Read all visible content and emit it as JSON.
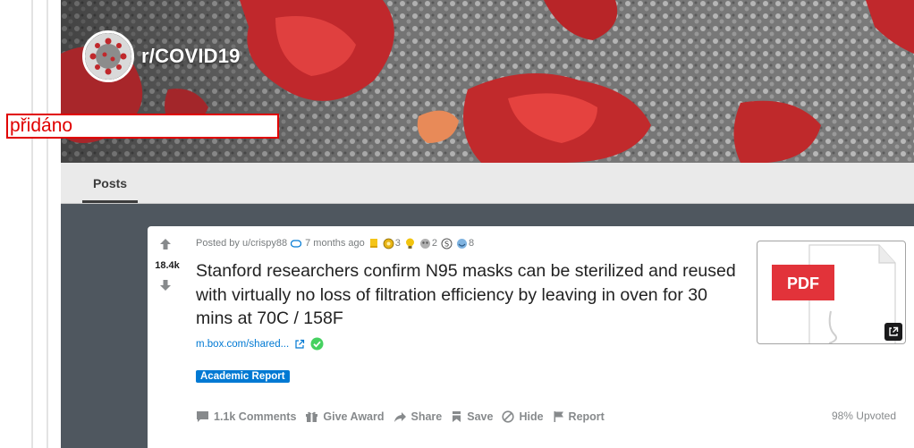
{
  "subreddit": {
    "name": "r/COVID19",
    "icon": "virus-icon"
  },
  "overlay_label": "přidáno",
  "tabs": [
    {
      "label": "Posts"
    }
  ],
  "post": {
    "votes": "18.4k",
    "posted_by": "Posted by u/crispy88",
    "time": "7 months ago",
    "awards": [
      {
        "icon": "silver-award-icon",
        "count": ""
      },
      {
        "icon": "gold-award-icon",
        "count": "3"
      },
      {
        "icon": "helpful-award-icon",
        "count": ""
      },
      {
        "icon": "wholesome-award-icon",
        "count": "2"
      },
      {
        "icon": "money-award-icon",
        "count": ""
      },
      {
        "icon": "facepalm-award-icon",
        "count": "8"
      }
    ],
    "title": "Stanford researchers confirm N95 masks can be sterilized and reused with virtually no loss of filtration efficiency by leaving in oven for 30 mins at 70C / 158F",
    "link": "m.box.com/shared...",
    "flair": "Academic Report",
    "thumbnail_label": "PDF",
    "actions": {
      "comments": "1.1k Comments",
      "award": "Give Award",
      "share": "Share",
      "save": "Save",
      "hide": "Hide",
      "report": "Report"
    },
    "upvoted": "98% Upvoted"
  },
  "colors": {
    "accent": "#0079d3",
    "flair_bg": "#0079d3",
    "verified": "#46d160",
    "overlay_border": "#e00000"
  }
}
